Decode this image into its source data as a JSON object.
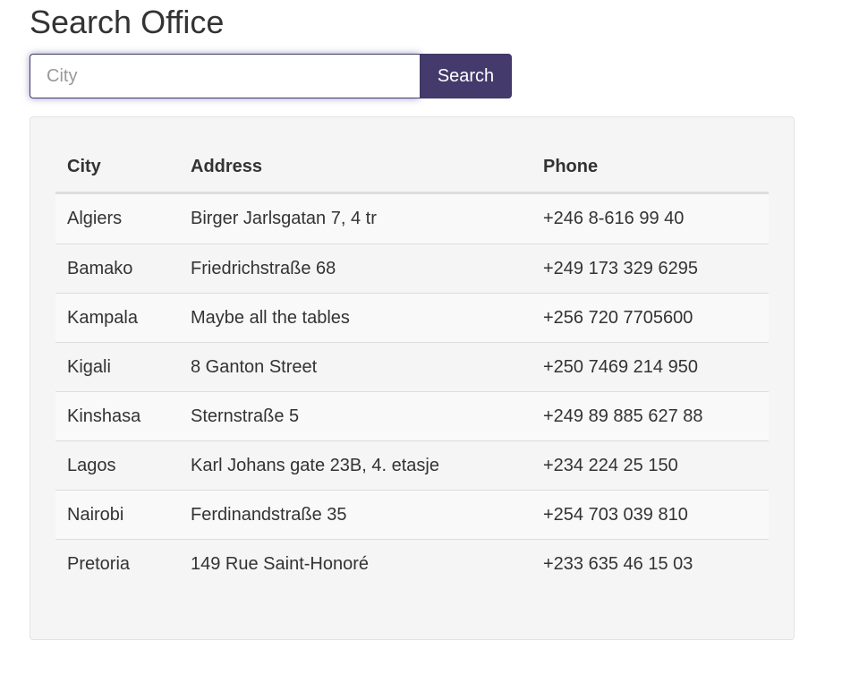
{
  "page": {
    "title": "Search Office"
  },
  "search": {
    "placeholder": "City",
    "value": "",
    "button_label": "Search"
  },
  "table": {
    "headers": {
      "city": "City",
      "address": "Address",
      "phone": "Phone"
    },
    "rows": [
      {
        "city": "Algiers",
        "address": "Birger Jarlsgatan 7, 4 tr",
        "phone": "+246 8-616 99 40"
      },
      {
        "city": "Bamako",
        "address": "Friedrichstraße 68",
        "phone": "+249 173 329 6295"
      },
      {
        "city": "Kampala",
        "address": "Maybe all the tables",
        "phone": "+256 720 7705600"
      },
      {
        "city": "Kigali",
        "address": "8 Ganton Street",
        "phone": "+250 7469 214 950"
      },
      {
        "city": "Kinshasa",
        "address": "Sternstraße 5",
        "phone": "+249 89 885 627 88"
      },
      {
        "city": "Lagos",
        "address": "Karl Johans gate 23B, 4. etasje",
        "phone": "+234 224 25 150"
      },
      {
        "city": "Nairobi",
        "address": "Ferdinandstraße 35",
        "phone": "+254 703 039 810"
      },
      {
        "city": "Pretoria",
        "address": "149 Rue Saint-Honoré",
        "phone": "+233 635 46 15 03"
      }
    ]
  },
  "colors": {
    "accent": "#443a6c",
    "panel_background": "#f5f5f5",
    "text": "#333333"
  }
}
